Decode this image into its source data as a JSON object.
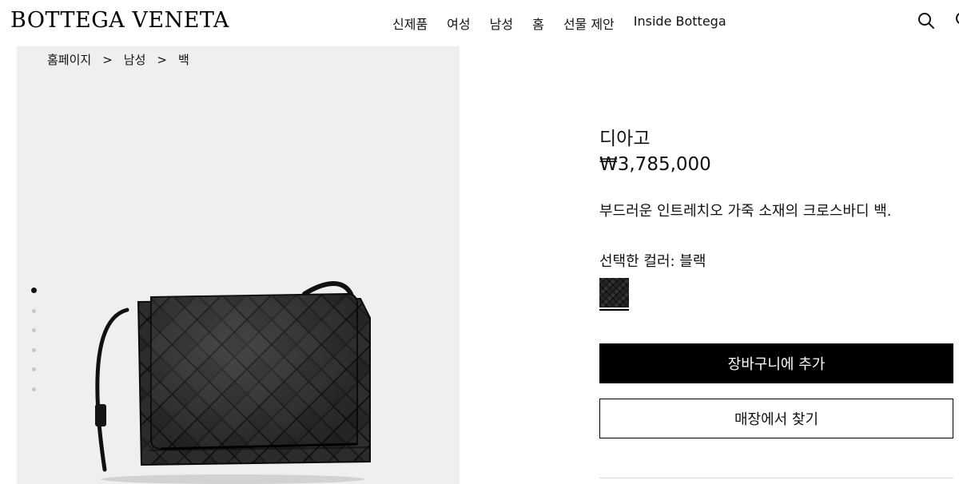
{
  "header": {
    "logo": "BOTTEGA VENETA",
    "nav": [
      "신제품",
      "여성",
      "남성",
      "홈",
      "선물 제안",
      "Inside Bottega"
    ],
    "icons": [
      "search-icon",
      "account-icon"
    ]
  },
  "breadcrumb": [
    "홈페이지",
    "남성",
    "백"
  ],
  "breadcrumb_separator": ">",
  "gallery": {
    "image_count": 6,
    "active_index": 0,
    "background_color": "#eef0ef"
  },
  "product": {
    "name": "디아고",
    "price": "₩3,785,000",
    "description": "부드러운 인트레치오 가죽 소재의 크로스바디 백.",
    "color_label": "선택한 컬러: 블랙",
    "selected_color": "#1a1a1a"
  },
  "actions": {
    "add_to_cart": "장바구니에 추가",
    "find_in_store": "매장에서 찾기"
  }
}
